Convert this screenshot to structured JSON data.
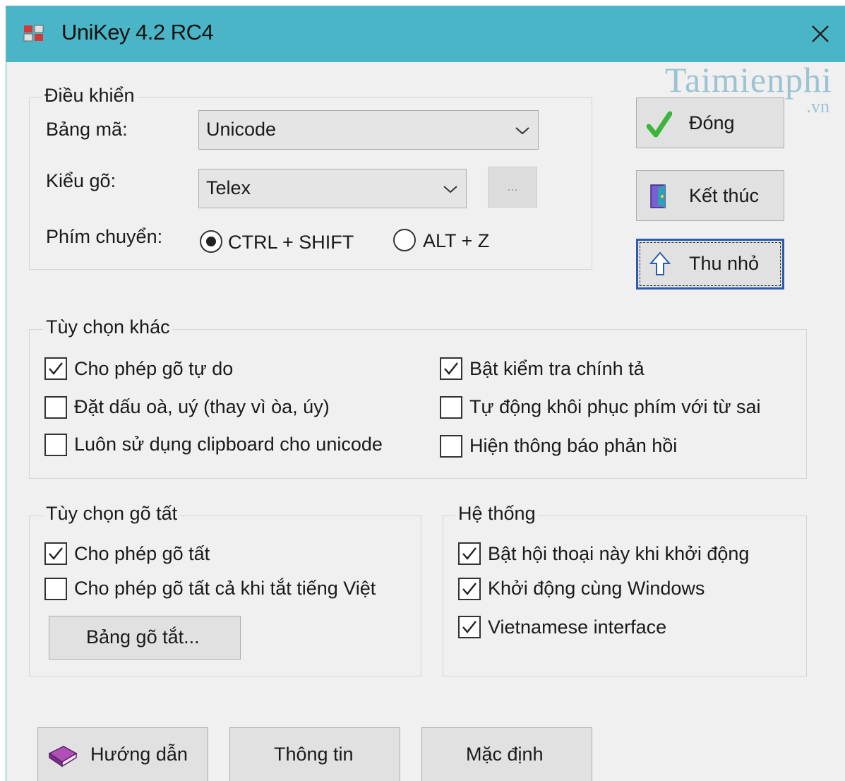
{
  "window": {
    "title": "UniKey 4.2 RC4"
  },
  "watermark": {
    "name": "Taimienphi",
    "suffix": ".vn"
  },
  "controls": {
    "legend": "Điều khiển",
    "charset_label": "Bảng mã:",
    "charset_value": "Unicode",
    "input_method_label": "Kiểu gõ:",
    "input_method_value": "Telex",
    "more_button": "...",
    "switch_key_label": "Phím chuyển:",
    "switch_options": [
      {
        "label": "CTRL + SHIFT",
        "selected": true
      },
      {
        "label": "ALT + Z",
        "selected": false
      }
    ]
  },
  "side_buttons": {
    "close": "Đóng",
    "exit": "Kết thúc",
    "minimize": "Thu nhỏ"
  },
  "other_options": {
    "legend": "Tùy chọn khác",
    "items": [
      {
        "label": "Cho phép gõ tự do",
        "checked": true
      },
      {
        "label": "Bật kiểm tra chính tả",
        "checked": true
      },
      {
        "label": "Đặt dấu oà, uý (thay vì òa, úy)",
        "checked": false
      },
      {
        "label": "Tự động khôi phục phím với từ sai",
        "checked": false
      },
      {
        "label": "Luôn sử dụng clipboard cho unicode",
        "checked": false
      },
      {
        "label": "Hiện thông báo phản hồi",
        "checked": false
      }
    ]
  },
  "macro_options": {
    "legend": "Tùy chọn gõ tất",
    "items": [
      {
        "label": "Cho phép gõ tất",
        "checked": true
      },
      {
        "label": "Cho phép gõ tất cả khi tắt tiếng Việt",
        "checked": false
      }
    ],
    "table_button": "Bảng gõ tắt..."
  },
  "system": {
    "legend": "Hệ thống",
    "items": [
      {
        "label": "Bật hội thoại này khi khởi động",
        "checked": true
      },
      {
        "label": "Khởi động cùng Windows",
        "checked": true
      },
      {
        "label": "Vietnamese interface",
        "checked": true
      }
    ]
  },
  "bottom_buttons": {
    "help": "Hướng dẫn",
    "info": "Thông tin",
    "default": "Mặc định"
  },
  "colors": {
    "titlebar": "#4bb5c8",
    "focus_border": "#2a5db0",
    "check_green": "#3bb53b"
  },
  "icons": [
    "app-logo-icon",
    "close-icon",
    "checkmark-icon",
    "door-icon",
    "arrow-up-icon",
    "book-icon",
    "chevron-down-icon"
  ]
}
